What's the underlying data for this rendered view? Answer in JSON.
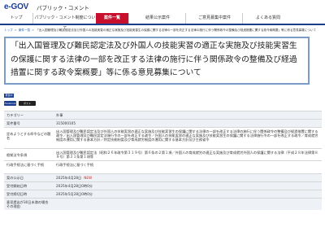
{
  "header": {
    "logo": "e-GOV",
    "site_name": "パブリック・コメント"
  },
  "nav": [
    {
      "label": "トップ",
      "active": false
    },
    {
      "label": "パブリック・コメント制度について",
      "active": false
    },
    {
      "label": "案件一覧",
      "active": true
    },
    {
      "label": "結果公示案件",
      "active": false
    },
    {
      "label": "ご意見募集中案件",
      "active": false
    },
    {
      "label": "よくある質問",
      "active": false
    }
  ],
  "breadcrumb": [
    "トップ",
    "案件一覧",
    "「出入国管理及び難民認定法及び外国人の技能実習の適正な実施及び技能実習生の保護に関する法律の一部を改正する法律の施行に伴う関係政令の整備及び経過措置に関する政令案概要」等に係る意見募集について"
  ],
  "title": "「出入国管理及び難民認定法及び外国人の技能実習の適正な実施及び技能実習生の保護に関する法律の一部を改正する法律の施行に伴う関係政令の整備及び経過措置に関する政令案概要」等に係る意見募集について",
  "buttons": {
    "small": "募集中",
    "facebook": "Facebook",
    "x": "ポスト(Twitter)"
  },
  "rows": [
    {
      "label": "カテゴリー",
      "value": "外事"
    },
    {
      "label": "案件番号",
      "value": "315000105"
    },
    {
      "label": "定めようとする命令などの題名",
      "value": "出入国管理及び難民認定法及び外国人の技能実習の適正な実施及び技能実習生の保護に関する法律の一部を改正する法律の施行に伴う関係政令の整備及び経過措置に関する政令／出入国管理及び難民認定法施行令の一部を改正する政令／外国人の技能実習の適正な実施及び技能実習生の保護に関する法律施行令の一部を改正する政令／育成就労制度の運用に関する基本方針／特定技能制度及び育成就労制度の運用に関する基本方針及び主務省令"
    },
    {
      "label": "根拠法令条項",
      "value": "出入国管理及び難民認定法（昭和２６年政令第３１９号）第６条の２第１項／外国人の育成就労の適正な実施及び育成就労外国人の保護に関する法律（平成２８年法律第８９号）第３１条第１項等"
    },
    {
      "label": "行政手続法に基づく手続",
      "value": "行政手続法に基づく手続"
    },
    {
      "label": "案の公示日",
      "value": "2025年4月28日",
      "badge": "NEW"
    },
    {
      "label": "受付開始日時",
      "value": "2025年4月28日0時0分"
    },
    {
      "label": "受付締切日時",
      "value": "2025年5月28日0時0分"
    },
    {
      "label": "意見提出が30日未満の場合その理由",
      "value": ""
    }
  ]
}
